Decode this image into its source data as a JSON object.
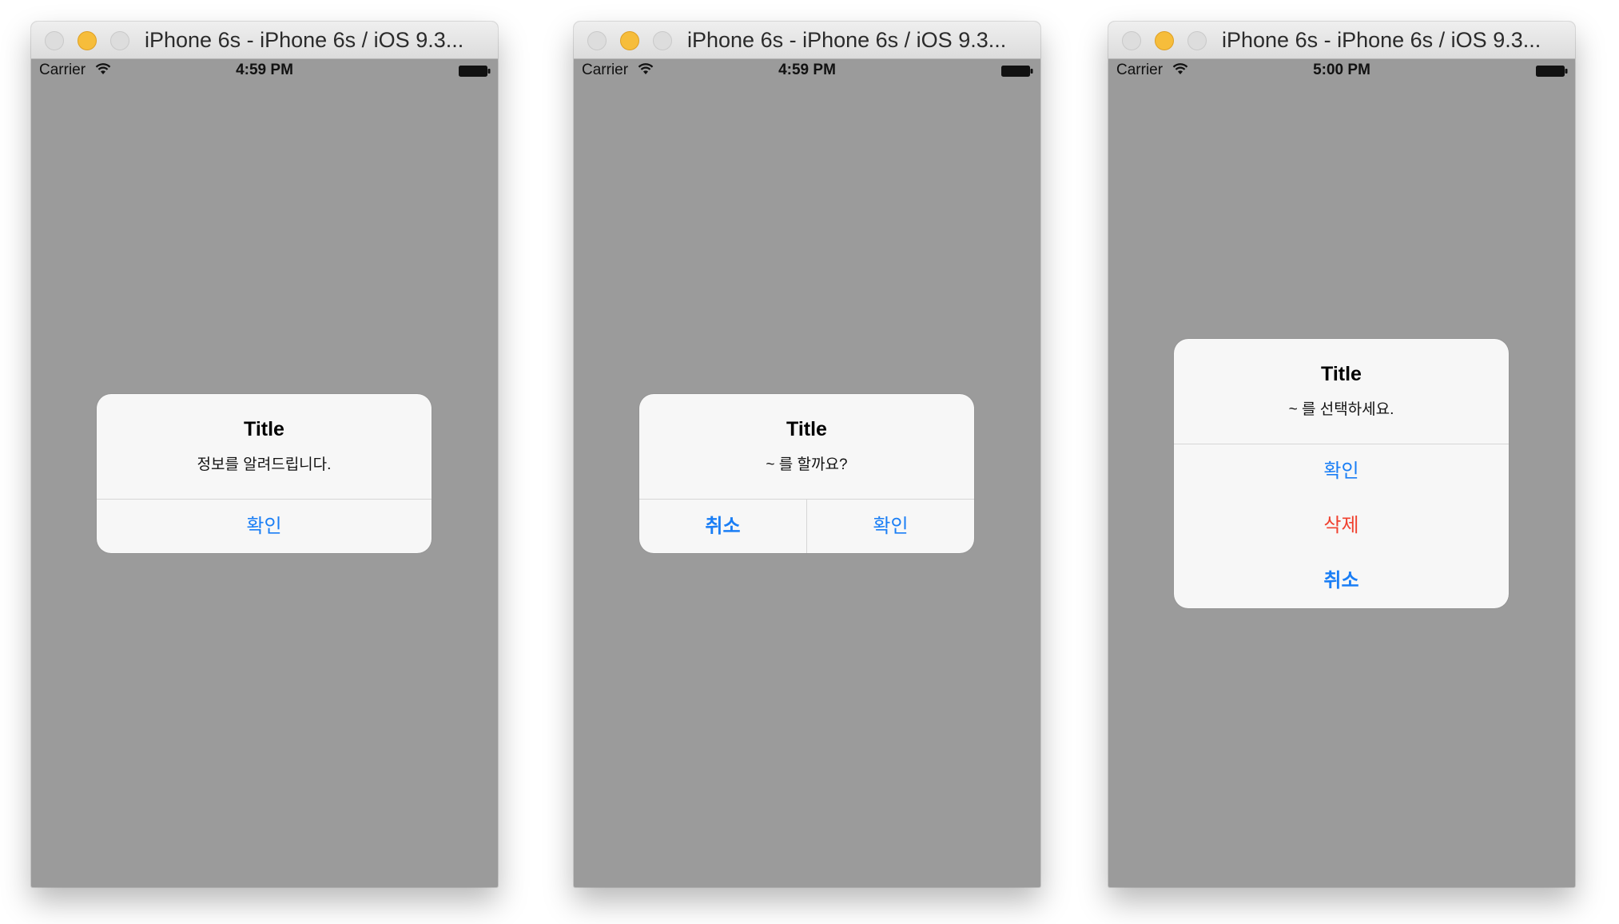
{
  "colors": {
    "screen_background": "#9b9b9b",
    "alert_background": "#f7f7f7",
    "action_blue": "#1a7ef5",
    "destructive_red": "#f0412f"
  },
  "windows": [
    {
      "window_title": "iPhone 6s - iPhone 6s / iOS 9.3...",
      "status": {
        "carrier": "Carrier",
        "time": "4:59 PM"
      },
      "alert": {
        "title": "Title",
        "message": "정보를 알려드립니다.",
        "buttons": [
          {
            "label": "확인",
            "style": "default"
          }
        ]
      }
    },
    {
      "window_title": "iPhone 6s - iPhone 6s / iOS 9.3...",
      "status": {
        "carrier": "Carrier",
        "time": "4:59 PM"
      },
      "alert": {
        "title": "Title",
        "message": "~ 를 할까요?",
        "buttons": [
          {
            "label": "취소",
            "style": "cancel"
          },
          {
            "label": "확인",
            "style": "default"
          }
        ]
      }
    },
    {
      "window_title": "iPhone 6s - iPhone 6s / iOS 9.3...",
      "status": {
        "carrier": "Carrier",
        "time": "5:00 PM"
      },
      "alert": {
        "title": "Title",
        "message": "~ 를 선택하세요.",
        "buttons": [
          {
            "label": "확인",
            "style": "default"
          },
          {
            "label": "삭제",
            "style": "destructive"
          },
          {
            "label": "취소",
            "style": "cancel"
          }
        ]
      }
    }
  ]
}
